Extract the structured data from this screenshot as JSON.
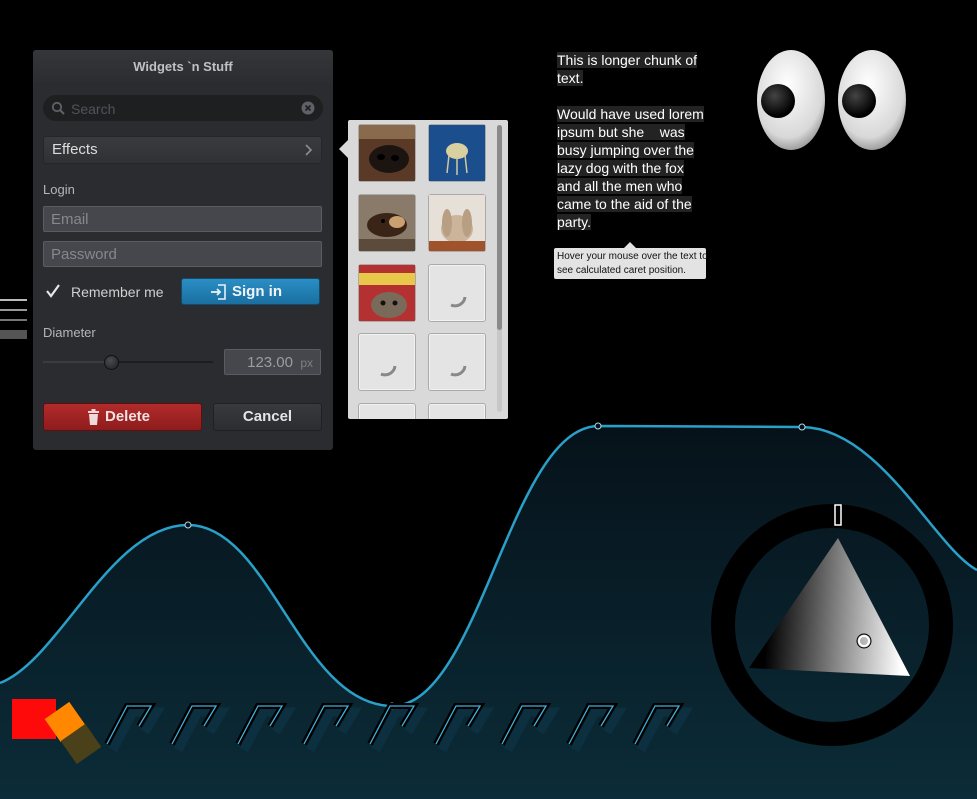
{
  "window": {
    "title": "Widgets `n Stuff",
    "search": {
      "placeholder": "Search",
      "value": ""
    },
    "effects_label": "Effects",
    "login_label": "Login",
    "email_placeholder": "Email",
    "password_placeholder": "Password",
    "remember_label": "Remember me",
    "remember_checked": true,
    "signin_label": "Sign in",
    "diameter_label": "Diameter",
    "diameter_value": "123.00",
    "diameter_unit": "px",
    "diameter_slider_fraction": 0.4,
    "delete_label": "Delete",
    "cancel_label": "Cancel"
  },
  "image_popup": {
    "thumbnails": [
      {
        "name": "dog-nose",
        "loaded": true
      },
      {
        "name": "jellyfish",
        "loaded": true
      },
      {
        "name": "animal-cub",
        "loaded": true
      },
      {
        "name": "rabbit",
        "loaded": true
      },
      {
        "name": "kitten",
        "loaded": true
      },
      {
        "name": "loading",
        "loaded": false
      },
      {
        "name": "loading",
        "loaded": false
      },
      {
        "name": "loading",
        "loaded": false
      },
      {
        "name": "loading",
        "loaded": false
      },
      {
        "name": "loading",
        "loaded": false
      }
    ]
  },
  "paragraph": {
    "lines": [
      "This is longer chunk of",
      "text.",
      "",
      "Would have used lorem",
      "ipsum but she    was",
      "busy jumping over the",
      "lazy dog with the fox",
      "and all the men who",
      "came to the aid of the",
      "party."
    ],
    "tooltip_lines": [
      "Hover your mouse over the text to",
      "see calculated caret position."
    ]
  },
  "colors": {
    "graph_line": "#2aa0c8",
    "sign_in": "#1f7fb3",
    "delete": "#a02424",
    "popup_bg": "#d9d9d9"
  },
  "icons": [
    "search-icon",
    "clear-icon",
    "chevron-right-icon",
    "check-icon",
    "login-icon",
    "trash-icon",
    "spinner-icon",
    "eye-icon"
  ]
}
